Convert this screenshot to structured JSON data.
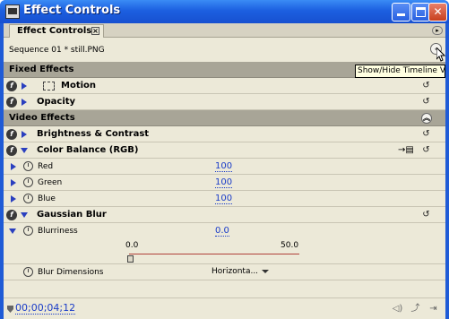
{
  "window": {
    "title": "Effect Controls"
  },
  "tab": {
    "label": "Effect Controls"
  },
  "sequence": {
    "label": "Sequence 01 * still.PNG"
  },
  "tooltip": {
    "text": "Show/Hide Timeline View"
  },
  "sections": {
    "fixed": "Fixed Effects",
    "video": "Video Effects"
  },
  "effects": {
    "motion": "Motion",
    "opacity": "Opacity",
    "brightness": "Brightness & Contrast",
    "color_balance": "Color Balance (RGB)",
    "gaussian_blur": "Gaussian Blur"
  },
  "properties": {
    "red": {
      "label": "Red",
      "value": "100"
    },
    "green": {
      "label": "Green",
      "value": "100"
    },
    "blue": {
      "label": "Blue",
      "value": "100"
    },
    "blurriness": {
      "label": "Blurriness",
      "value": "0.0"
    },
    "blur_dimensions": {
      "label": "Blur Dimensions",
      "value": "Horizonta..."
    }
  },
  "slider": {
    "min": "0.0",
    "max": "50.0",
    "value": 0.0
  },
  "footer": {
    "timecode": "00;00;04;12"
  },
  "colors": {
    "title_bar": "#1f5bd6",
    "panel": "#ece9d8",
    "value_link": "#1a3cc8",
    "header_row": "#a8a597"
  },
  "icons": [
    "fx-toggle-icon",
    "stopwatch-icon",
    "reset-icon",
    "timeline-toggle-icon",
    "collapse-icon"
  ]
}
